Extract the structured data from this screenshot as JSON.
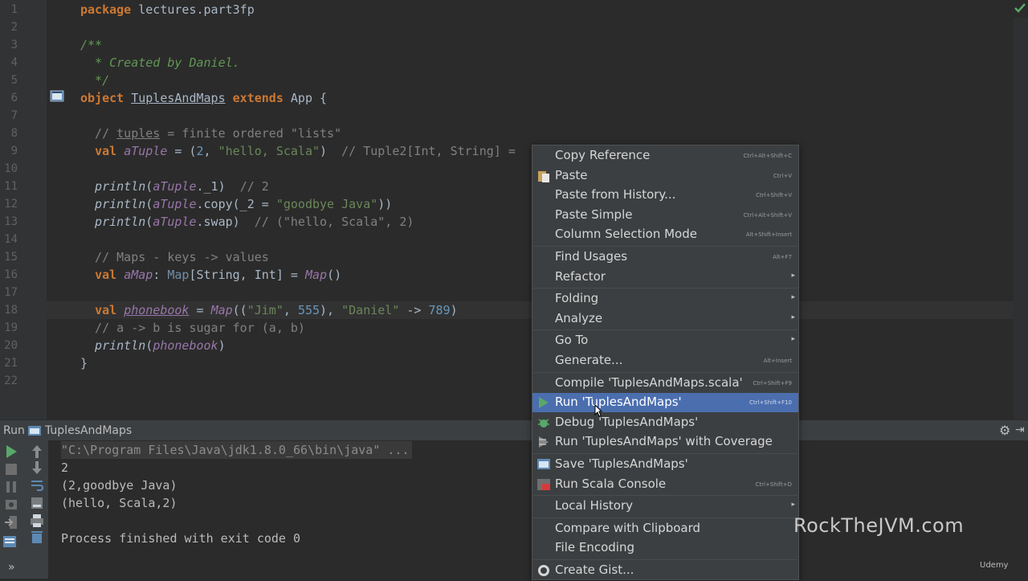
{
  "editor": {
    "line_numbers": [
      "1",
      "2",
      "3",
      "4",
      "5",
      "6",
      "7",
      "8",
      "9",
      "10",
      "11",
      "12",
      "13",
      "14",
      "15",
      "16",
      "17",
      "18",
      "19",
      "20",
      "21",
      "22"
    ],
    "lines": [
      {
        "n": 1,
        "parts": [
          {
            "c": "kw",
            "t": "package"
          },
          {
            "c": "",
            "t": " lectures.part3fp"
          }
        ]
      },
      {
        "n": 3,
        "parts": [
          {
            "c": "doc",
            "t": "/**"
          }
        ]
      },
      {
        "n": 4,
        "parts": [
          {
            "c": "doc",
            "t": "  * Created by Daniel."
          }
        ]
      },
      {
        "n": 5,
        "parts": [
          {
            "c": "doc",
            "t": "  */"
          }
        ]
      },
      {
        "n": 6,
        "parts": [
          {
            "c": "kw",
            "t": "object"
          },
          {
            "c": "",
            "t": " "
          },
          {
            "c": "ul",
            "t": "TuplesAndMaps"
          },
          {
            "c": "",
            "t": " "
          },
          {
            "c": "kw",
            "t": "extends"
          },
          {
            "c": "",
            "t": " App {"
          }
        ]
      },
      {
        "n": 8,
        "parts": [
          {
            "c": "cm",
            "t": "  // "
          },
          {
            "c": "cm ul",
            "t": "tuples"
          },
          {
            "c": "cm",
            "t": " = finite ordered \"lists\""
          }
        ]
      },
      {
        "n": 9,
        "parts": [
          {
            "c": "",
            "t": "  "
          },
          {
            "c": "kw",
            "t": "val"
          },
          {
            "c": "",
            "t": " "
          },
          {
            "c": "it",
            "t": "aTuple"
          },
          {
            "c": "",
            "t": " = ("
          },
          {
            "c": "num",
            "t": "2"
          },
          {
            "c": "",
            "t": ", "
          },
          {
            "c": "str",
            "t": "\"hello, Scala\""
          },
          {
            "c": "",
            "t": ")  "
          },
          {
            "c": "cm",
            "t": "// Tuple2[Int, String] ="
          }
        ]
      },
      {
        "n": 11,
        "parts": [
          {
            "c": "fn",
            "t": "  println"
          },
          {
            "c": "",
            "t": "("
          },
          {
            "c": "it",
            "t": "aTuple"
          },
          {
            "c": "",
            "t": "._1)  "
          },
          {
            "c": "cm",
            "t": "// 2"
          }
        ]
      },
      {
        "n": 12,
        "parts": [
          {
            "c": "fn",
            "t": "  println"
          },
          {
            "c": "",
            "t": "("
          },
          {
            "c": "it",
            "t": "aTuple"
          },
          {
            "c": "",
            "t": ".copy(_2 = "
          },
          {
            "c": "str",
            "t": "\"goodbye Java\""
          },
          {
            "c": "",
            "t": "))"
          }
        ]
      },
      {
        "n": 13,
        "parts": [
          {
            "c": "fn",
            "t": "  println"
          },
          {
            "c": "",
            "t": "("
          },
          {
            "c": "it",
            "t": "aTuple"
          },
          {
            "c": "",
            "t": ".swap)  "
          },
          {
            "c": "cm",
            "t": "// (\"hello, Scala\", 2)"
          }
        ]
      },
      {
        "n": 15,
        "parts": [
          {
            "c": "cm",
            "t": "  // Maps - keys -> values"
          }
        ]
      },
      {
        "n": 16,
        "parts": [
          {
            "c": "",
            "t": "  "
          },
          {
            "c": "kw",
            "t": "val"
          },
          {
            "c": "",
            "t": " "
          },
          {
            "c": "it",
            "t": "aMap"
          },
          {
            "c": "",
            "t": ": "
          },
          {
            "c": "ty",
            "t": "Map"
          },
          {
            "c": "",
            "t": "[String, Int] = "
          },
          {
            "c": "it",
            "t": "Map"
          },
          {
            "c": "",
            "t": "()"
          }
        ]
      },
      {
        "n": 18,
        "parts": [
          {
            "c": "",
            "t": "  "
          },
          {
            "c": "kw",
            "t": "val"
          },
          {
            "c": "",
            "t": " "
          },
          {
            "c": "it ul",
            "t": "phonebook"
          },
          {
            "c": "",
            "t": " = "
          },
          {
            "c": "it",
            "t": "Map"
          },
          {
            "c": "",
            "t": "(("
          },
          {
            "c": "str",
            "t": "\"Jim\""
          },
          {
            "c": "",
            "t": ", "
          },
          {
            "c": "num",
            "t": "555"
          },
          {
            "c": "",
            "t": "), "
          },
          {
            "c": "str",
            "t": "\"Daniel\""
          },
          {
            "c": "",
            "t": " -> "
          },
          {
            "c": "num",
            "t": "789"
          },
          {
            "c": "",
            "t": ")"
          }
        ]
      },
      {
        "n": 19,
        "parts": [
          {
            "c": "cm",
            "t": "  // a -> b is sugar for (a, b)"
          }
        ]
      },
      {
        "n": 20,
        "parts": [
          {
            "c": "fn",
            "t": "  println"
          },
          {
            "c": "",
            "t": "("
          },
          {
            "c": "it",
            "t": "phonebook"
          },
          {
            "c": "",
            "t": ")"
          }
        ]
      },
      {
        "n": 21,
        "parts": [
          {
            "c": "",
            "t": "}"
          }
        ]
      }
    ]
  },
  "run_panel": {
    "tab_label": "Run",
    "config_name": "TuplesAndMaps",
    "console_lines": [
      "\"C:\\Program Files\\Java\\jdk1.8.0_66\\bin\\java\" ...",
      "2",
      "(2,goodbye Java)",
      "(hello, Scala,2)",
      "",
      "Process finished with exit code 0"
    ]
  },
  "context_menu": {
    "items": [
      {
        "label": "Copy Reference",
        "shortcut": "Ctrl+Alt+Shift+C",
        "icon": "",
        "submenu": false
      },
      {
        "label": "Paste",
        "shortcut": "Ctrl+V",
        "icon": "paste-icon",
        "submenu": false
      },
      {
        "label": "Paste from History...",
        "shortcut": "Ctrl+Shift+V",
        "icon": "",
        "submenu": false
      },
      {
        "label": "Paste Simple",
        "shortcut": "Ctrl+Alt+Shift+V",
        "icon": "",
        "submenu": false
      },
      {
        "label": "Column Selection Mode",
        "shortcut": "Alt+Shift+Insert",
        "icon": "",
        "submenu": false,
        "sep_after": true
      },
      {
        "label": "Find Usages",
        "shortcut": "Alt+F7",
        "icon": "",
        "submenu": false
      },
      {
        "label": "Refactor",
        "shortcut": "",
        "icon": "",
        "submenu": true,
        "sep_after": true
      },
      {
        "label": "Folding",
        "shortcut": "",
        "icon": "",
        "submenu": true
      },
      {
        "label": "Analyze",
        "shortcut": "",
        "icon": "",
        "submenu": true,
        "sep_after": true
      },
      {
        "label": "Go To",
        "shortcut": "",
        "icon": "",
        "submenu": true
      },
      {
        "label": "Generate...",
        "shortcut": "Alt+Insert",
        "icon": "",
        "submenu": false,
        "sep_after": true
      },
      {
        "label": "Compile 'TuplesAndMaps.scala'",
        "shortcut": "Ctrl+Shift+F9",
        "icon": "",
        "submenu": false
      },
      {
        "label": "Run 'TuplesAndMaps'",
        "shortcut": "Ctrl+Shift+F10",
        "icon": "run-icon",
        "submenu": false,
        "selected": true
      },
      {
        "label": "Debug 'TuplesAndMaps'",
        "shortcut": "",
        "icon": "debug-icon",
        "submenu": false
      },
      {
        "label": "Run 'TuplesAndMaps' with Coverage",
        "shortcut": "",
        "icon": "coverage-icon",
        "submenu": false,
        "sep_after": true
      },
      {
        "label": "Save 'TuplesAndMaps'",
        "shortcut": "",
        "icon": "save-config-icon",
        "submenu": false
      },
      {
        "label": "Run Scala Console",
        "shortcut": "Ctrl+Shift+D",
        "icon": "scala-console-icon",
        "submenu": false,
        "sep_after": true
      },
      {
        "label": "Local History",
        "shortcut": "",
        "icon": "",
        "submenu": true,
        "sep_after": true
      },
      {
        "label": "Compare with Clipboard",
        "shortcut": "",
        "icon": "",
        "submenu": false
      },
      {
        "label": "File Encoding",
        "shortcut": "",
        "icon": "",
        "submenu": false,
        "sep_after": true
      },
      {
        "label": "Create Gist...",
        "shortcut": "",
        "icon": "gist-icon",
        "submenu": false
      }
    ]
  },
  "watermark": "RockTheJVM.com",
  "udemy_label": "Udemy",
  "colors": {
    "selection": "#4b6eaf",
    "keyword": "#cc7832",
    "string": "#6a8759",
    "number": "#6897bb",
    "comment": "#808080",
    "run_green": "#59a869"
  }
}
